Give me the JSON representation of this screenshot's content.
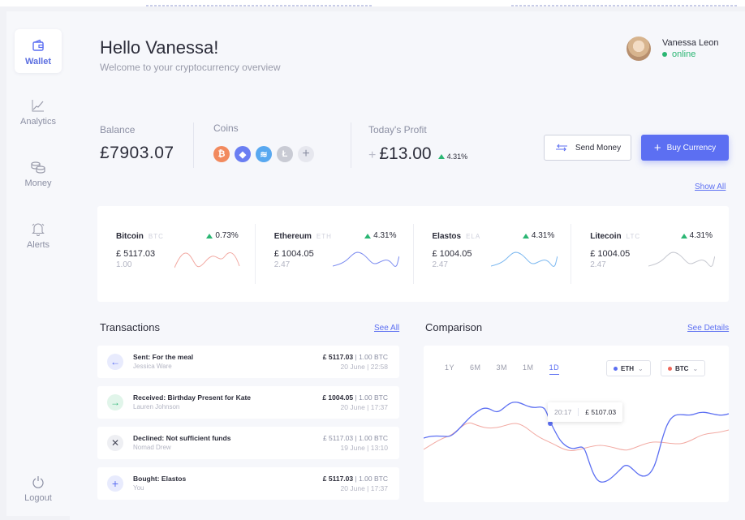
{
  "sidebar": {
    "items": [
      {
        "label": "Wallet",
        "icon": "wallet-icon"
      },
      {
        "label": "Analytics",
        "icon": "chart-icon"
      },
      {
        "label": "Money",
        "icon": "coins-icon"
      },
      {
        "label": "Alerts",
        "icon": "bell-icon"
      }
    ],
    "logout": "Logout"
  },
  "header": {
    "greeting": "Hello Vanessa!",
    "subtitle": "Welcome to your cryptocurrency overview"
  },
  "user": {
    "name": "Vanessa Leon",
    "status": "online"
  },
  "stats": {
    "balance_label": "Balance",
    "balance": "£7903.07",
    "coins_label": "Coins",
    "profit_label": "Today's Profit",
    "profit_sign": "+",
    "profit": "£13.00",
    "profit_pct": "4.31%"
  },
  "actions": {
    "send": "Send Money",
    "buy": "Buy Currency",
    "show_all": "Show All"
  },
  "colors": {
    "accent": "#5c6ff2",
    "up": "#2bb673",
    "eth": "#5c6ff2",
    "btc": "#f0675a"
  },
  "markets": [
    {
      "name": "Bitcoin",
      "ticker": "BTC",
      "change": "0.73%",
      "price": "£ 5117.03",
      "amount": "1.00",
      "color": "#f2a9a2"
    },
    {
      "name": "Ethereum",
      "ticker": "ETH",
      "change": "4.31%",
      "price": "£ 1004.05",
      "amount": "2.47",
      "color": "#7c8cf0"
    },
    {
      "name": "Elastos",
      "ticker": "ELA",
      "change": "4.31%",
      "price": "£ 1004.05",
      "amount": "2.47",
      "color": "#7cb8f0"
    },
    {
      "name": "Litecoin",
      "ticker": "LTC",
      "change": "4.31%",
      "price": "£ 1004.05",
      "amount": "2.47",
      "color": "#c6c8d0"
    }
  ],
  "transactions": {
    "title": "Transactions",
    "see_all": "See All",
    "items": [
      {
        "icon": "arrow-left-icon",
        "title": "Sent: For the meal",
        "who": "Jessica Ware",
        "amount": "£ 5117.03",
        "units": "| 1.00 BTC",
        "date": "20 June | 22:58"
      },
      {
        "icon": "arrow-right-icon",
        "title": "Received: Birthday Present for Kate",
        "who": "Lauren Johnson",
        "amount": "£ 1004.05",
        "units": "| 1.00 BTC",
        "date": "20 June | 17:37"
      },
      {
        "icon": "close-icon",
        "title": "Declined: Not sufficient funds",
        "who": "Nomad Drew",
        "amount": "£ 5117.03",
        "units": "| 1.00 BTC",
        "date": "19 June | 13:10"
      },
      {
        "icon": "plus-icon",
        "title": "Bought: Elastos",
        "who": "You",
        "amount": "£ 5117.03",
        "units": "| 1.00 BTC",
        "date": "20 June | 17:37"
      }
    ]
  },
  "comparison": {
    "title": "Comparison",
    "see_details": "See Details",
    "ranges": [
      "1Y",
      "6M",
      "3M",
      "1M",
      "1D"
    ],
    "active_range": "1D",
    "series_a": "ETH",
    "series_b": "BTC",
    "tooltip_time": "20:17",
    "tooltip_value": "£ 5107.03"
  }
}
